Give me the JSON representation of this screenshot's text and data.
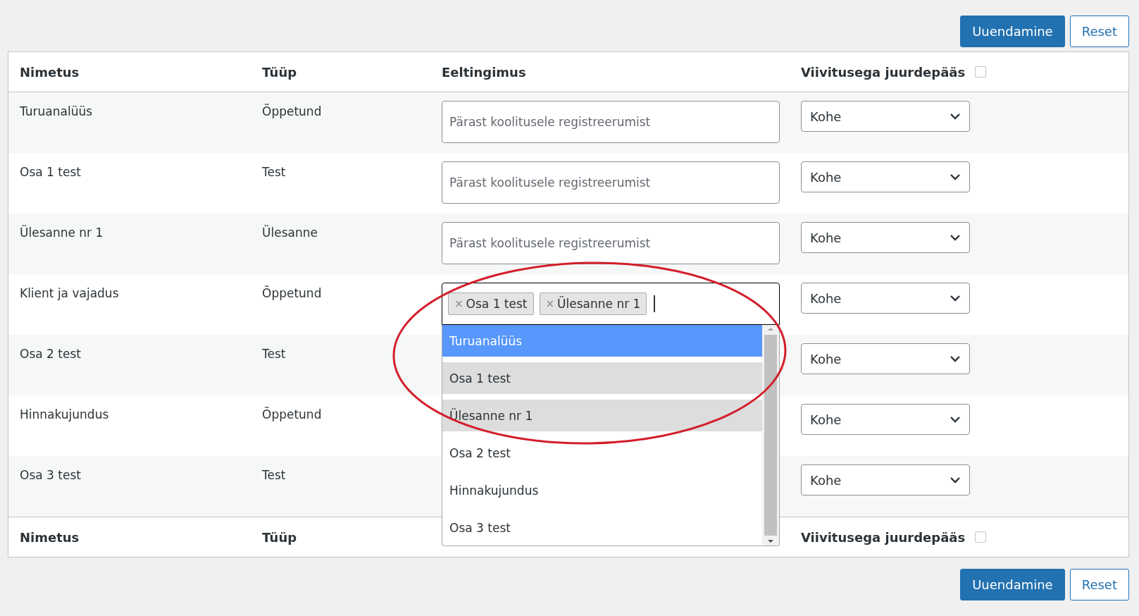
{
  "top_actions": [
    {
      "label": "Uuendamine",
      "kind": "primary"
    },
    {
      "label": "Reset",
      "kind": "secondary"
    }
  ],
  "table": {
    "columns": [
      {
        "label": "Nimetus"
      },
      {
        "label": "Tüüp"
      },
      {
        "label": "Eeltingimus"
      },
      {
        "label": "Viivitusega juurdepääs",
        "checked": false
      }
    ],
    "rows": [
      {
        "name": "Turuanalüüs",
        "type": "Õppetund",
        "prerequisite": {
          "kind": "text",
          "placeholder": "Pärast koolitusele registreerumist"
        },
        "delay": "Kohe"
      },
      {
        "name": "Osa 1 test",
        "type": "Test",
        "prerequisite": {
          "kind": "text",
          "placeholder": "Pärast koolitusele registreerumist"
        },
        "delay": "Kohe"
      },
      {
        "name": "Ülesanne nr 1",
        "type": "Ülesanne",
        "prerequisite": {
          "kind": "text",
          "placeholder": "Pärast koolitusele registreerumist"
        },
        "delay": "Kohe"
      },
      {
        "name": "Klient ja vajadus",
        "type": "Õppetund",
        "prerequisite": {
          "kind": "tags",
          "tags": [
            "Osa 1 test",
            "Ülesanne nr 1"
          ],
          "remove_symbol": "×",
          "options": [
            {
              "label": "Turuanalüüs",
              "highlighted": true,
              "selected": false
            },
            {
              "label": "Osa 1 test",
              "highlighted": false,
              "selected": true
            },
            {
              "label": "Ülesanne nr 1",
              "highlighted": false,
              "selected": true
            },
            {
              "label": "Osa 2 test",
              "highlighted": false,
              "selected": false
            },
            {
              "label": "Hinnakujundus",
              "highlighted": false,
              "selected": false
            },
            {
              "label": "Osa 3 test",
              "highlighted": false,
              "selected": false
            }
          ]
        },
        "delay": "Kohe"
      },
      {
        "name": "Osa 2 test",
        "type": "Test",
        "delay": "Kohe"
      },
      {
        "name": "Hinnakujundus",
        "type": "Õppetund",
        "delay": "Kohe"
      },
      {
        "name": "Osa 3 test",
        "type": "Test",
        "delay": "Kohe"
      }
    ],
    "footer_columns": [
      {
        "label": "Nimetus"
      },
      {
        "label": "Tüüp"
      },
      {
        "label": "Viivitusega juurdepääs",
        "checked": false
      }
    ]
  },
  "bottom_actions": [
    {
      "label": "Uuendamine",
      "kind": "primary"
    },
    {
      "label": "Reset",
      "kind": "secondary"
    }
  ],
  "annotation": {
    "kind": "ellipse"
  }
}
